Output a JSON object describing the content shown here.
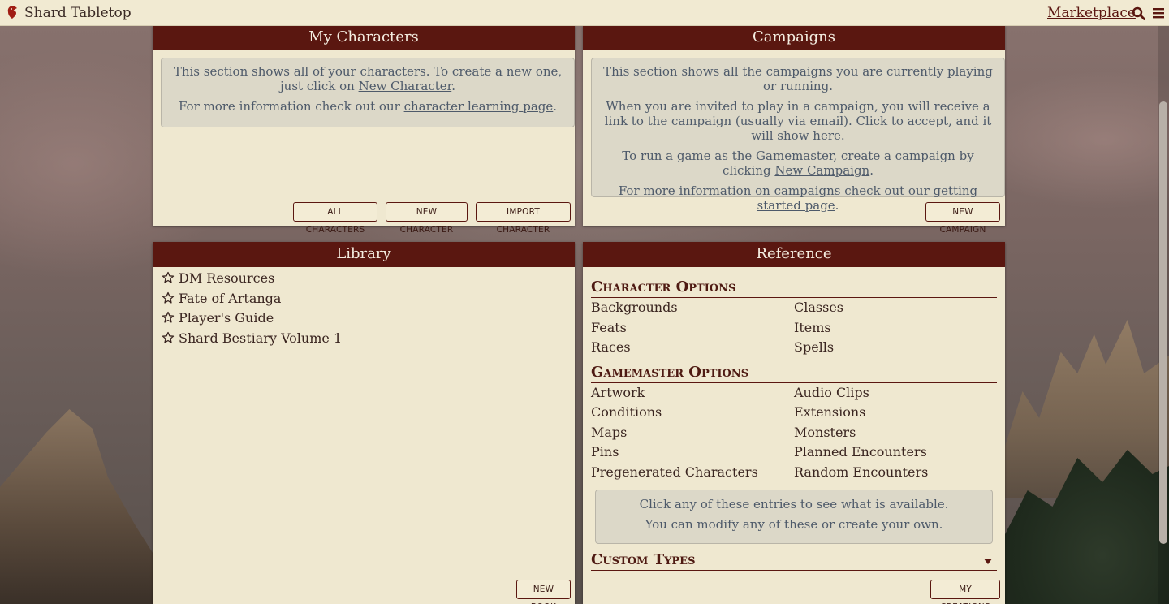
{
  "app": {
    "title": "Shard Tabletop",
    "marketplace": "Marketplace"
  },
  "characters": {
    "title": "My Characters",
    "info_line1": "This section shows all of your characters. To create a new one, just click on",
    "info_link1": "New Character",
    "info_line2_prefix": "For more information check out our",
    "info_link2": "character learning page",
    "buttons": {
      "all": "ALL CHARACTERS",
      "new": "NEW CHARACTER",
      "import": "IMPORT CHARACTER"
    }
  },
  "campaigns": {
    "title": "Campaigns",
    "p1": "This section shows all the campaigns you are currently playing or running.",
    "p2": "When you are invited to play in a campaign, you will receive a link to the campaign (usually via email). Click to accept, and it will show here.",
    "p3_prefix": "To run a game as the Gamemaster, create a campaign by clicking",
    "p3_link": "New Campaign",
    "p4_prefix": "For more information on campaigns check out our",
    "p4_link": "getting started page",
    "button_new": "NEW CAMPAIGN"
  },
  "library": {
    "title": "Library",
    "items": [
      "DM Resources",
      "Fate of Artanga",
      "Player's Guide",
      "Shard Bestiary Volume 1"
    ],
    "button_new": "NEW BOOK"
  },
  "reference": {
    "title": "Reference",
    "character_options_title": "Character Options",
    "character_options": [
      "Backgrounds",
      "Classes",
      "Feats",
      "Items",
      "Races",
      "Spells"
    ],
    "gamemaster_options_title": "Gamemaster Options",
    "gamemaster_options": [
      "Artwork",
      "Audio Clips",
      "Conditions",
      "Extensions",
      "Maps",
      "Monsters",
      "Pins",
      "Planned Encounters",
      "Pregenerated Characters",
      "Random Encounters"
    ],
    "info_line1": "Click any of these entries to see what is available.",
    "info_line2": "You can modify any of these or create your own.",
    "custom_types_title": "Custom Types",
    "button_creations": "MY CREATIONS"
  },
  "colors": {
    "header": "#5a1710",
    "panel": "#efe8d0",
    "topbar": "#f1ead2",
    "info_box": "#dcd8c8"
  },
  "icons": [
    "logo-dragon-icon",
    "search-icon",
    "menu-icon",
    "star-icon",
    "chevron-down-icon"
  ]
}
